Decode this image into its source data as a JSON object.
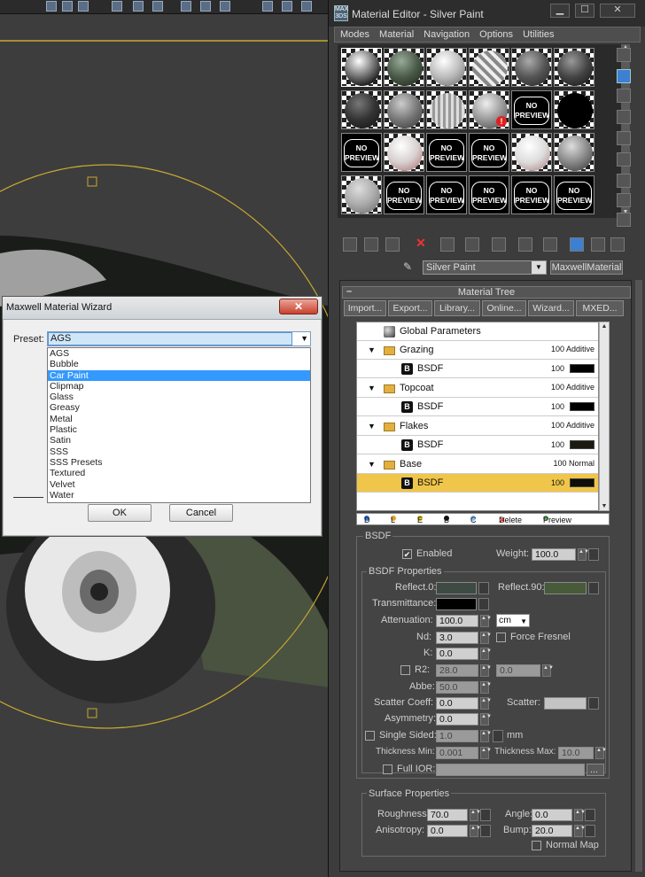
{
  "wizard": {
    "title": "Maxwell Material Wizard",
    "close_glyph": "✕",
    "preset_label": "Preset:",
    "preset_selected": "AGS",
    "options": [
      "AGS",
      "Bubble",
      "Car Paint",
      "Clipmap",
      "Glass",
      "Greasy",
      "Metal",
      "Plastic",
      "Satin",
      "SSS",
      "SSS Presets",
      "Textured",
      "Velvet",
      "Water"
    ],
    "highlighted_option": "Car Paint",
    "ok_label": "OK",
    "cancel_label": "Cancel"
  },
  "editor": {
    "title": "Material Editor - Silver Paint",
    "logo_text": "MAX 3DS",
    "window_buttons": [
      "▁",
      "☐",
      "✕"
    ],
    "menu": [
      "Modes",
      "Material",
      "Navigation",
      "Options",
      "Utilities"
    ],
    "no_preview_text": "NO PREVIEW",
    "warning_glyph": "!",
    "material_name": "Silver Paint",
    "material_type": "MaxwellMaterial",
    "delete_glyph": "✕",
    "picker_glyph": "✎",
    "arrow_glyph": "▼",
    "up_glyph": "▲"
  },
  "material_tree": {
    "header": "Material Tree",
    "minus": "–",
    "buttons": [
      "Import...",
      "Export...",
      "Library...",
      "Online...",
      "Wizard...",
      "MXED..."
    ],
    "global_parameters": "Global Parameters",
    "layers": [
      {
        "name": "Grazing",
        "value": "100 Additive",
        "bsdf": "BSDF",
        "bsdf_value": "100"
      },
      {
        "name": "Topcoat",
        "value": "100 Additive",
        "bsdf": "BSDF",
        "bsdf_value": "100"
      },
      {
        "name": "Flakes",
        "value": "100 Additive",
        "bsdf": "BSDF",
        "bsdf_value": "100"
      },
      {
        "name": "Base",
        "value": "100 Normal",
        "bsdf": "BSDF",
        "bsdf_value": "100"
      }
    ],
    "bsdf_icon": "B",
    "legend": {
      "d": "D",
      "l": "L",
      "e": "E",
      "b": "B",
      "c": "C",
      "delete": "Delete",
      "preview": "Preview"
    },
    "colors": {
      "d": "#3a6fd8",
      "l": "#e0a030",
      "e": "#e0c020",
      "b": "#111111",
      "c": "#88bbee"
    }
  },
  "bsdf": {
    "section_title": "BSDF",
    "enabled_label": "Enabled",
    "weight_label": "Weight:",
    "weight_value": "100.0",
    "properties_title": "BSDF Properties",
    "reflect0_label": "Reflect.0:",
    "reflect90_label": "Reflect.90:",
    "transmittance_label": "Transmittance:",
    "attenuation_label": "Attenuation:",
    "attenuation_value": "100.0",
    "attenuation_unit": "cm",
    "nd_label": "Nd:",
    "nd_value": "3.0",
    "force_fresnel_label": "Force Fresnel",
    "k_label": "K:",
    "k_value": "0.0",
    "r2_label": "R2:",
    "r2_value": "28.0",
    "r2_value2": "0.0",
    "abbe_label": "Abbe:",
    "abbe_value": "50.0",
    "scatter_coeff_label": "Scatter Coeff:",
    "scatter_coeff_value": "0.0",
    "scatter_label": "Scatter:",
    "asymmetry_label": "Asymmetry:",
    "asymmetry_value": "0.0",
    "single_sided_label": "Single Sided:",
    "single_sided_value": "1.0",
    "single_sided_unit": "mm",
    "thickness_min_label": "Thickness Min:",
    "thickness_min_value": "0.001",
    "thickness_max_label": "Thickness Max:",
    "thickness_max_value": "10.0",
    "full_ior_label": "Full IOR:",
    "full_ior_button": "...",
    "colors": {
      "reflect0": "#3e4a44",
      "reflect90": "#475a3a",
      "transmittance": "#000000",
      "scatter": "#c4c4c4"
    }
  },
  "surface": {
    "title": "Surface Properties",
    "roughness_label": "Roughness:",
    "roughness_value": "70.0",
    "angle_label": "Angle:",
    "angle_value": "0.0",
    "anisotropy_label": "Anisotropy:",
    "anisotropy_value": "0.0",
    "bump_label": "Bump:",
    "bump_value": "20.0",
    "normal_map_label": "Normal Map"
  }
}
